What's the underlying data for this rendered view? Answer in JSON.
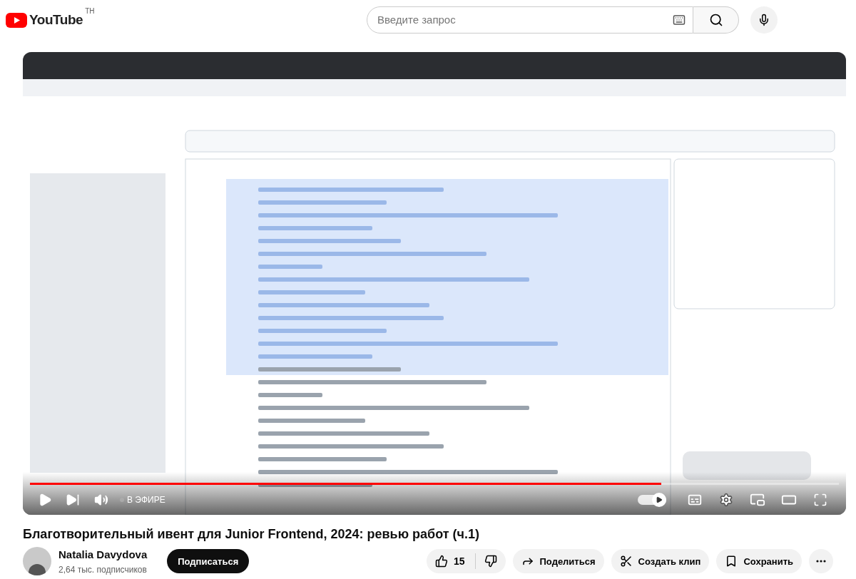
{
  "header": {
    "logo_text": "YouTube",
    "region": "TH",
    "search": {
      "placeholder": "Введите запрос"
    }
  },
  "player": {
    "progress": {
      "level": 0.78
    },
    "live_label": "В ЭФИРЕ",
    "autoplay": {
      "on": true
    }
  },
  "video": {
    "title": "Благотворительный ивент для Junior Frontend, 2024: ревью работ (ч.1)"
  },
  "channel": {
    "name": "Natalia Davydova",
    "subscribers": "2,64 тыс. подписчиков",
    "subscribe_label": "Подписаться"
  },
  "actions": {
    "likes": "15",
    "share": "Поделиться",
    "clip": "Создать клип",
    "save": "Сохранить"
  }
}
